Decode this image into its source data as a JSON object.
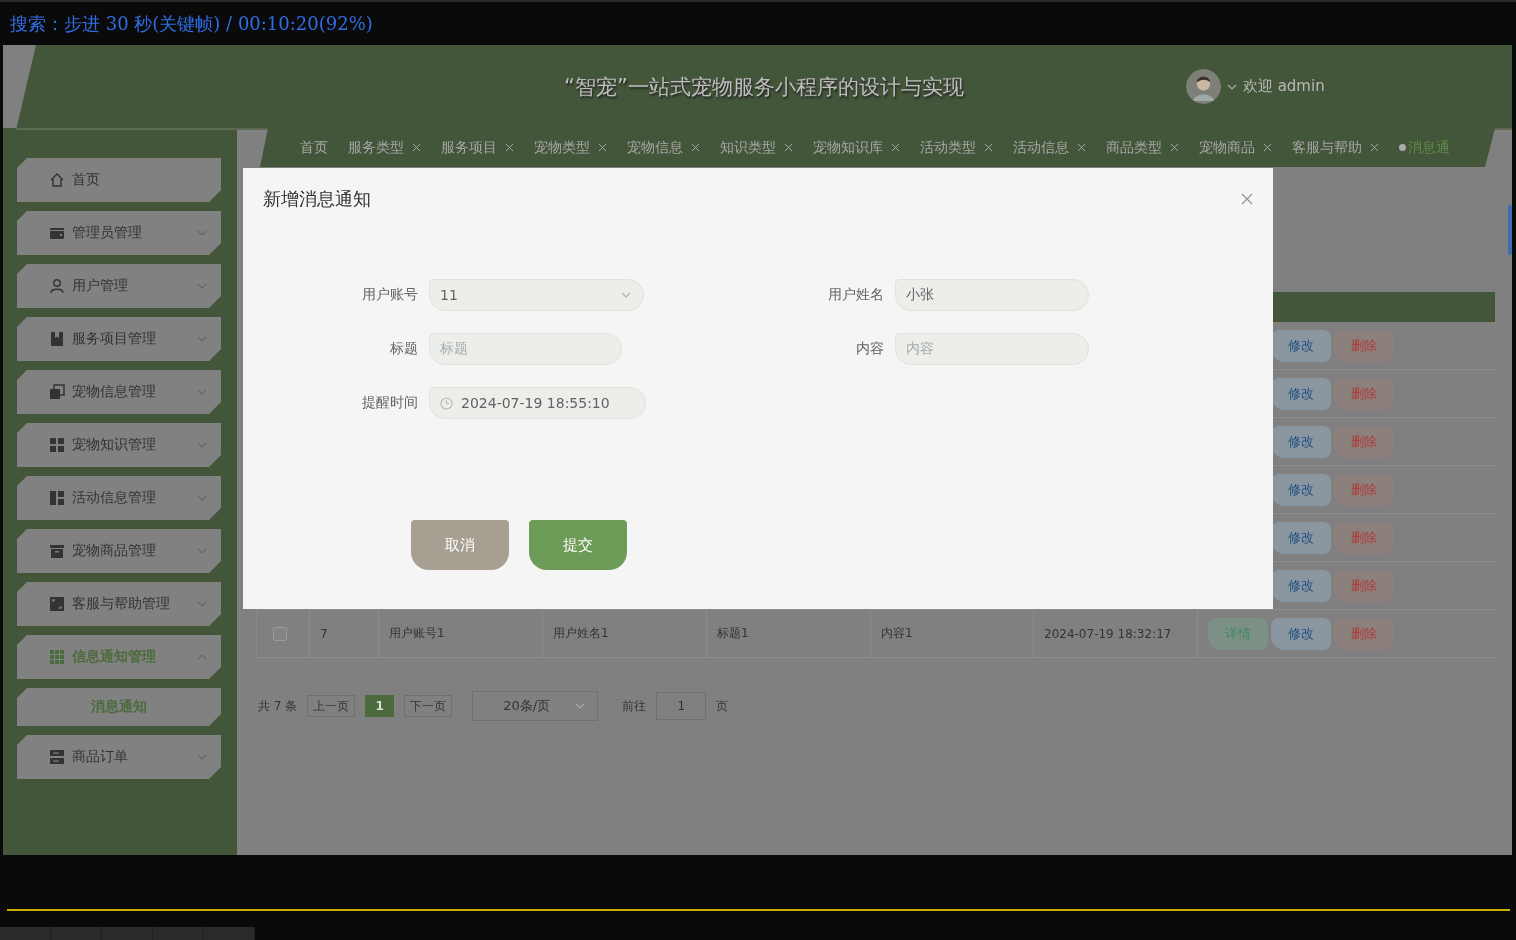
{
  "player_status": "搜索：步进 30 秒(关键帧) / 00:10:20(92%)",
  "header": {
    "title": "“智宠”一站式宠物服务小程序的设计与实现",
    "welcome": "欢迎 admin"
  },
  "sidebar": {
    "items": [
      {
        "label": "首页",
        "kind": "link"
      },
      {
        "label": "管理员管理",
        "kind": "menu",
        "expanded": false
      },
      {
        "label": "用户管理",
        "kind": "menu",
        "expanded": false
      },
      {
        "label": "服务项目管理",
        "kind": "menu",
        "expanded": false
      },
      {
        "label": "宠物信息管理",
        "kind": "menu",
        "expanded": false
      },
      {
        "label": "宠物知识管理",
        "kind": "menu",
        "expanded": false
      },
      {
        "label": "活动信息管理",
        "kind": "menu",
        "expanded": false
      },
      {
        "label": "宠物商品管理",
        "kind": "menu",
        "expanded": false
      },
      {
        "label": "客服与帮助管理",
        "kind": "menu",
        "expanded": false
      },
      {
        "label": "信息通知管理",
        "kind": "menu",
        "expanded": true,
        "children": [
          {
            "label": "消息通知",
            "selected": true
          }
        ]
      },
      {
        "label": "商品订单",
        "kind": "menu",
        "expanded": false
      }
    ]
  },
  "tabs": [
    {
      "label": "首页",
      "closable": false,
      "selected": false
    },
    {
      "label": "服务类型",
      "closable": true,
      "selected": false
    },
    {
      "label": "服务项目",
      "closable": true,
      "selected": false
    },
    {
      "label": "宠物类型",
      "closable": true,
      "selected": false
    },
    {
      "label": "宠物信息",
      "closable": true,
      "selected": false
    },
    {
      "label": "知识类型",
      "closable": true,
      "selected": false
    },
    {
      "label": "宠物知识库",
      "closable": true,
      "selected": false
    },
    {
      "label": "活动类型",
      "closable": true,
      "selected": false
    },
    {
      "label": "活动信息",
      "closable": true,
      "selected": false
    },
    {
      "label": "商品类型",
      "closable": true,
      "selected": false
    },
    {
      "label": "宠物商品",
      "closable": true,
      "selected": false
    },
    {
      "label": "客服与帮助",
      "closable": true,
      "selected": false
    },
    {
      "label": "消息通",
      "closable": false,
      "selected": true
    }
  ],
  "table": {
    "rows": [
      {
        "actions": [
          {
            "label": "修改",
            "kind": "edit"
          },
          {
            "label": "删除",
            "kind": "delete"
          }
        ]
      },
      {
        "actions": [
          {
            "label": "修改",
            "kind": "edit"
          },
          {
            "label": "删除",
            "kind": "delete"
          }
        ]
      },
      {
        "actions": [
          {
            "label": "修改",
            "kind": "edit"
          },
          {
            "label": "删除",
            "kind": "delete"
          }
        ]
      },
      {
        "actions": [
          {
            "label": "修改",
            "kind": "edit"
          },
          {
            "label": "删除",
            "kind": "delete"
          }
        ]
      },
      {
        "actions": [
          {
            "label": "修改",
            "kind": "edit"
          },
          {
            "label": "删除",
            "kind": "delete"
          }
        ]
      },
      {
        "actions": [
          {
            "label": "修改",
            "kind": "edit"
          },
          {
            "label": "删除",
            "kind": "delete"
          }
        ]
      },
      {
        "checked": false,
        "cells": [
          "7",
          "用户账号1",
          "用户姓名1",
          "标题1",
          "内容1",
          "2024-07-19 18:32:17"
        ],
        "actions": [
          {
            "label": "详情",
            "kind": "detail"
          },
          {
            "label": "修改",
            "kind": "edit"
          },
          {
            "label": "删除",
            "kind": "delete"
          }
        ]
      }
    ]
  },
  "pagination": {
    "total": "共 7 条",
    "prev": "上一页",
    "pages": [
      {
        "label": "1",
        "selected": true
      }
    ],
    "next": "下一页",
    "page_size": "20条/页",
    "goto_label": "前往",
    "goto_value": "1",
    "page_unit": "页"
  },
  "dialog": {
    "title": "新增消息通知",
    "fields": [
      {
        "label": "用户账号",
        "kind": "select",
        "value": "11"
      },
      {
        "label": "用户姓名",
        "kind": "text",
        "value": "小张"
      },
      {
        "label": "标题",
        "kind": "text",
        "placeholder": "标题"
      },
      {
        "label": "内容",
        "kind": "text",
        "placeholder": "内容"
      },
      {
        "label": "提醒时间",
        "kind": "date",
        "value": "2024-07-19 18:55:10"
      }
    ],
    "buttons": [
      {
        "label": "取消",
        "kind": "cancel"
      },
      {
        "label": "提交",
        "kind": "submit"
      }
    ]
  }
}
